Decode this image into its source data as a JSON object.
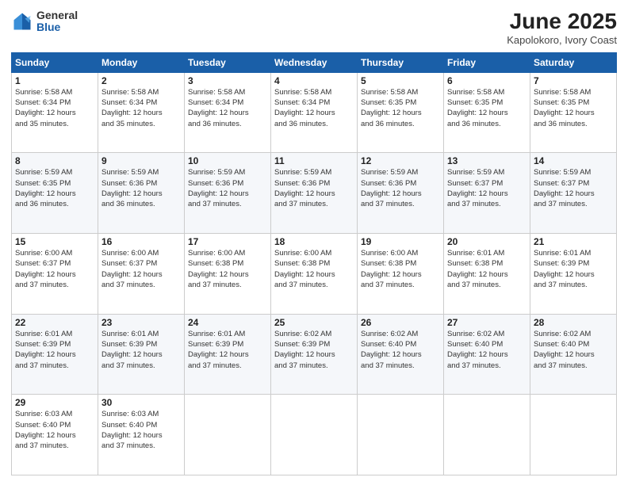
{
  "header": {
    "logo_general": "General",
    "logo_blue": "Blue",
    "title": "June 2025",
    "subtitle": "Kapolokoro, Ivory Coast"
  },
  "days_of_week": [
    "Sunday",
    "Monday",
    "Tuesday",
    "Wednesday",
    "Thursday",
    "Friday",
    "Saturday"
  ],
  "weeks": [
    [
      {
        "day": "1",
        "sunrise": "5:58 AM",
        "sunset": "6:34 PM",
        "daylight": "12 hours and 35 minutes."
      },
      {
        "day": "2",
        "sunrise": "5:58 AM",
        "sunset": "6:34 PM",
        "daylight": "12 hours and 35 minutes."
      },
      {
        "day": "3",
        "sunrise": "5:58 AM",
        "sunset": "6:34 PM",
        "daylight": "12 hours and 36 minutes."
      },
      {
        "day": "4",
        "sunrise": "5:58 AM",
        "sunset": "6:34 PM",
        "daylight": "12 hours and 36 minutes."
      },
      {
        "day": "5",
        "sunrise": "5:58 AM",
        "sunset": "6:35 PM",
        "daylight": "12 hours and 36 minutes."
      },
      {
        "day": "6",
        "sunrise": "5:58 AM",
        "sunset": "6:35 PM",
        "daylight": "12 hours and 36 minutes."
      },
      {
        "day": "7",
        "sunrise": "5:58 AM",
        "sunset": "6:35 PM",
        "daylight": "12 hours and 36 minutes."
      }
    ],
    [
      {
        "day": "8",
        "sunrise": "5:59 AM",
        "sunset": "6:35 PM",
        "daylight": "12 hours and 36 minutes."
      },
      {
        "day": "9",
        "sunrise": "5:59 AM",
        "sunset": "6:36 PM",
        "daylight": "12 hours and 36 minutes."
      },
      {
        "day": "10",
        "sunrise": "5:59 AM",
        "sunset": "6:36 PM",
        "daylight": "12 hours and 37 minutes."
      },
      {
        "day": "11",
        "sunrise": "5:59 AM",
        "sunset": "6:36 PM",
        "daylight": "12 hours and 37 minutes."
      },
      {
        "day": "12",
        "sunrise": "5:59 AM",
        "sunset": "6:36 PM",
        "daylight": "12 hours and 37 minutes."
      },
      {
        "day": "13",
        "sunrise": "5:59 AM",
        "sunset": "6:37 PM",
        "daylight": "12 hours and 37 minutes."
      },
      {
        "day": "14",
        "sunrise": "5:59 AM",
        "sunset": "6:37 PM",
        "daylight": "12 hours and 37 minutes."
      }
    ],
    [
      {
        "day": "15",
        "sunrise": "6:00 AM",
        "sunset": "6:37 PM",
        "daylight": "12 hours and 37 minutes."
      },
      {
        "day": "16",
        "sunrise": "6:00 AM",
        "sunset": "6:37 PM",
        "daylight": "12 hours and 37 minutes."
      },
      {
        "day": "17",
        "sunrise": "6:00 AM",
        "sunset": "6:38 PM",
        "daylight": "12 hours and 37 minutes."
      },
      {
        "day": "18",
        "sunrise": "6:00 AM",
        "sunset": "6:38 PM",
        "daylight": "12 hours and 37 minutes."
      },
      {
        "day": "19",
        "sunrise": "6:00 AM",
        "sunset": "6:38 PM",
        "daylight": "12 hours and 37 minutes."
      },
      {
        "day": "20",
        "sunrise": "6:01 AM",
        "sunset": "6:38 PM",
        "daylight": "12 hours and 37 minutes."
      },
      {
        "day": "21",
        "sunrise": "6:01 AM",
        "sunset": "6:39 PM",
        "daylight": "12 hours and 37 minutes."
      }
    ],
    [
      {
        "day": "22",
        "sunrise": "6:01 AM",
        "sunset": "6:39 PM",
        "daylight": "12 hours and 37 minutes."
      },
      {
        "day": "23",
        "sunrise": "6:01 AM",
        "sunset": "6:39 PM",
        "daylight": "12 hours and 37 minutes."
      },
      {
        "day": "24",
        "sunrise": "6:01 AM",
        "sunset": "6:39 PM",
        "daylight": "12 hours and 37 minutes."
      },
      {
        "day": "25",
        "sunrise": "6:02 AM",
        "sunset": "6:39 PM",
        "daylight": "12 hours and 37 minutes."
      },
      {
        "day": "26",
        "sunrise": "6:02 AM",
        "sunset": "6:40 PM",
        "daylight": "12 hours and 37 minutes."
      },
      {
        "day": "27",
        "sunrise": "6:02 AM",
        "sunset": "6:40 PM",
        "daylight": "12 hours and 37 minutes."
      },
      {
        "day": "28",
        "sunrise": "6:02 AM",
        "sunset": "6:40 PM",
        "daylight": "12 hours and 37 minutes."
      }
    ],
    [
      {
        "day": "29",
        "sunrise": "6:03 AM",
        "sunset": "6:40 PM",
        "daylight": "12 hours and 37 minutes."
      },
      {
        "day": "30",
        "sunrise": "6:03 AM",
        "sunset": "6:40 PM",
        "daylight": "12 hours and 37 minutes."
      },
      null,
      null,
      null,
      null,
      null
    ]
  ],
  "labels": {
    "sunrise": "Sunrise: ",
    "sunset": "Sunset: ",
    "daylight": "Daylight: "
  }
}
